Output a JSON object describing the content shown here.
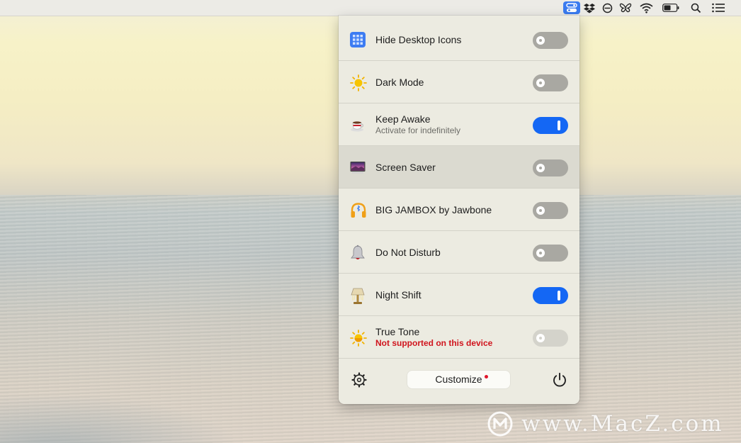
{
  "menubar": {
    "icons": [
      "one-switch-icon",
      "dropbox-icon",
      "no-entry-icon",
      "butterfly-icon",
      "wifi-icon",
      "battery-icon",
      "search-icon",
      "list-icon"
    ]
  },
  "panel": {
    "items": [
      {
        "label": "Hide Desktop Icons",
        "subtitle": "",
        "icon": "grid-icon",
        "state": "off"
      },
      {
        "label": "Dark Mode",
        "subtitle": "",
        "icon": "sun-icon",
        "state": "off"
      },
      {
        "label": "Keep Awake",
        "subtitle": "Activate for indefinitely",
        "icon": "coffee-cup-icon",
        "state": "on"
      },
      {
        "label": "Screen Saver",
        "subtitle": "",
        "icon": "screen-saver-icon",
        "state": "off",
        "selected": true
      },
      {
        "label": "BIG JAMBOX by Jawbone",
        "subtitle": "",
        "icon": "headphones-icon",
        "state": "off"
      },
      {
        "label": "Do Not Disturb",
        "subtitle": "",
        "icon": "bell-icon",
        "state": "off"
      },
      {
        "label": "Night Shift",
        "subtitle": "",
        "icon": "lamp-icon",
        "state": "on"
      },
      {
        "label": "True Tone",
        "subtitle": "Not supported on this device",
        "icon": "sun-half-icon",
        "state": "disabled"
      }
    ],
    "footer": {
      "customize_label": "Customize",
      "settings_icon": "gear-icon",
      "power_icon": "power-icon"
    }
  },
  "watermark": {
    "text": "www.MacZ.com"
  },
  "colors": {
    "accent": "#1467f4",
    "warning": "#d0141d"
  }
}
